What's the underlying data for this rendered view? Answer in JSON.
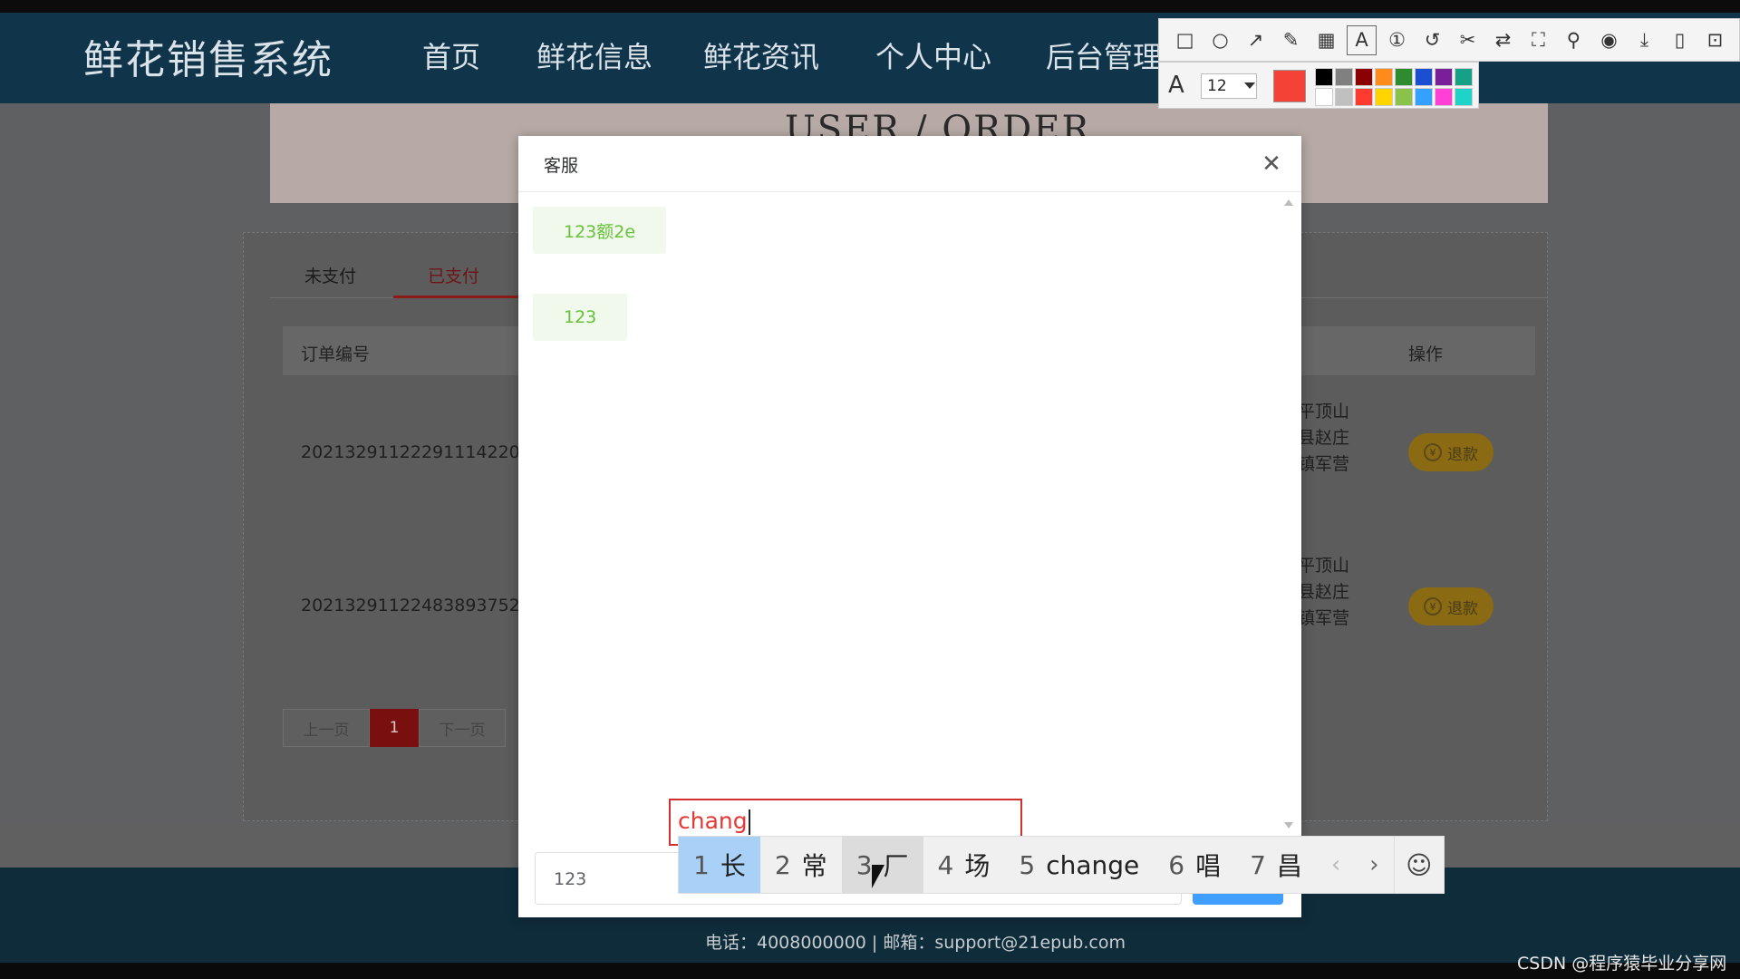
{
  "site": {
    "title": "鲜花销售系统",
    "nav": [
      "首页",
      "鲜花信息",
      "鲜花资讯",
      "个人中心",
      "后台管理"
    ]
  },
  "banner": {
    "text": "USER / ORDER"
  },
  "orders": {
    "tabs": [
      "未支付",
      "已支付"
    ],
    "active_tab": "已支付",
    "headers": {
      "order_no": "订单编号",
      "action": "操作"
    },
    "rows": [
      {
        "order_no": "20213291122291114220",
        "address": [
          "平顶山",
          "县赵庄",
          "镇军营"
        ],
        "action": "退款"
      },
      {
        "order_no": "20213291122483893752",
        "address": [
          "平顶山",
          "县赵庄",
          "镇军营"
        ],
        "action": "退款"
      }
    ],
    "pagination": {
      "prev": "上一页",
      "current": "1",
      "next": "下一页"
    }
  },
  "footer": {
    "contact": "电话：4008000000 | 邮箱：support@21epub.com"
  },
  "watermark": "CSDN @程序猿毕业分享网",
  "dialog": {
    "title": "客服",
    "messages": [
      "123额2e",
      "123"
    ],
    "input_value": "123"
  },
  "ime": {
    "composition": "chang",
    "candidates": [
      {
        "n": "1",
        "text": "长"
      },
      {
        "n": "2",
        "text": "常"
      },
      {
        "n": "3",
        "text": "厂"
      },
      {
        "n": "4",
        "text": "场"
      },
      {
        "n": "5",
        "text": "change"
      },
      {
        "n": "6",
        "text": "唱"
      },
      {
        "n": "7",
        "text": "昌"
      }
    ],
    "selected_index": 0,
    "prev_icon": "‹",
    "next_icon": "›",
    "emoji_icon": "☺"
  },
  "screenshot_tool": {
    "tools": [
      "rectangle-icon",
      "ellipse-icon",
      "arrow-icon",
      "pencil-icon",
      "mosaic-icon",
      "text-icon",
      "number-icon",
      "undo-icon",
      "cut-icon",
      "translate-icon",
      "crop-icon",
      "pin-icon",
      "record-icon",
      "download-icon",
      "long-screenshot-icon",
      "bookmark-icon"
    ],
    "active_tool": "text-icon",
    "font_size": "12",
    "current_color": "#f44336",
    "palette": [
      "#000000",
      "#808080",
      "#8b0000",
      "#ff8c1a",
      "#2e8b2e",
      "#1a4fd1",
      "#7a1f9a",
      "#16a085",
      "#ffffff",
      "#c0c0c0",
      "#ff3b30",
      "#ffd400",
      "#8bc34a",
      "#33a1ff",
      "#ff3fd6",
      "#1ed4c8"
    ]
  }
}
